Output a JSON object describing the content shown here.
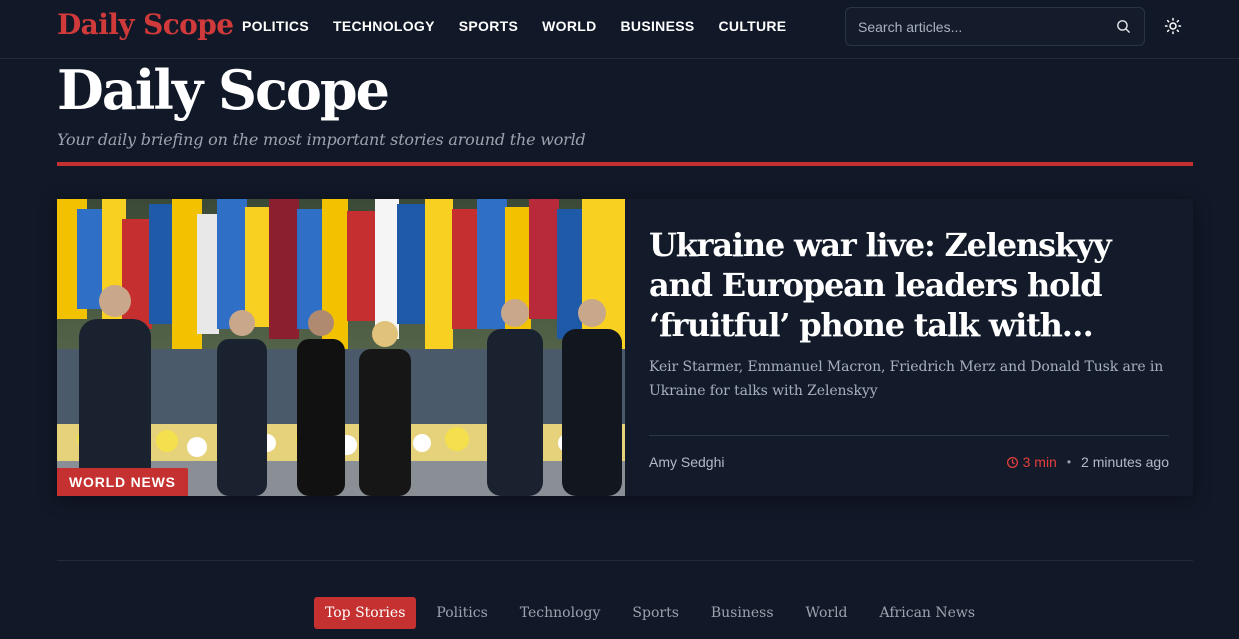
{
  "brand": {
    "logo": "Daily Scope",
    "accent": "#c53030"
  },
  "nav": {
    "links": [
      "POLITICS",
      "TECHNOLOGY",
      "SPORTS",
      "WORLD",
      "BUSINESS",
      "CULTURE"
    ]
  },
  "search": {
    "placeholder": "Search articles...",
    "value": "",
    "icon": "search-icon"
  },
  "theme_toggle": {
    "icon": "sun-icon"
  },
  "masthead": {
    "title": "Daily Scope",
    "tagline": "Your daily briefing on the most important stories around the world"
  },
  "featured": {
    "category": "WORLD NEWS",
    "headline": "Ukraine war live: Zelenskyy and European leaders hold ‘fruitful’ phone talk with…",
    "summary": "Keir Starmer, Emmanuel Macron, Friedrich Merz and Donald Tusk are in Ukraine for talks with Zelenskyy",
    "author": "Amy Sedghi",
    "read_time": "3 min",
    "published": "2 minutes ago",
    "image_alt": "Leaders walking past a memorial of flags"
  },
  "tabs": {
    "items": [
      "Top Stories",
      "Politics",
      "Technology",
      "Sports",
      "Business",
      "World",
      "African News"
    ],
    "active": "Top Stories"
  }
}
